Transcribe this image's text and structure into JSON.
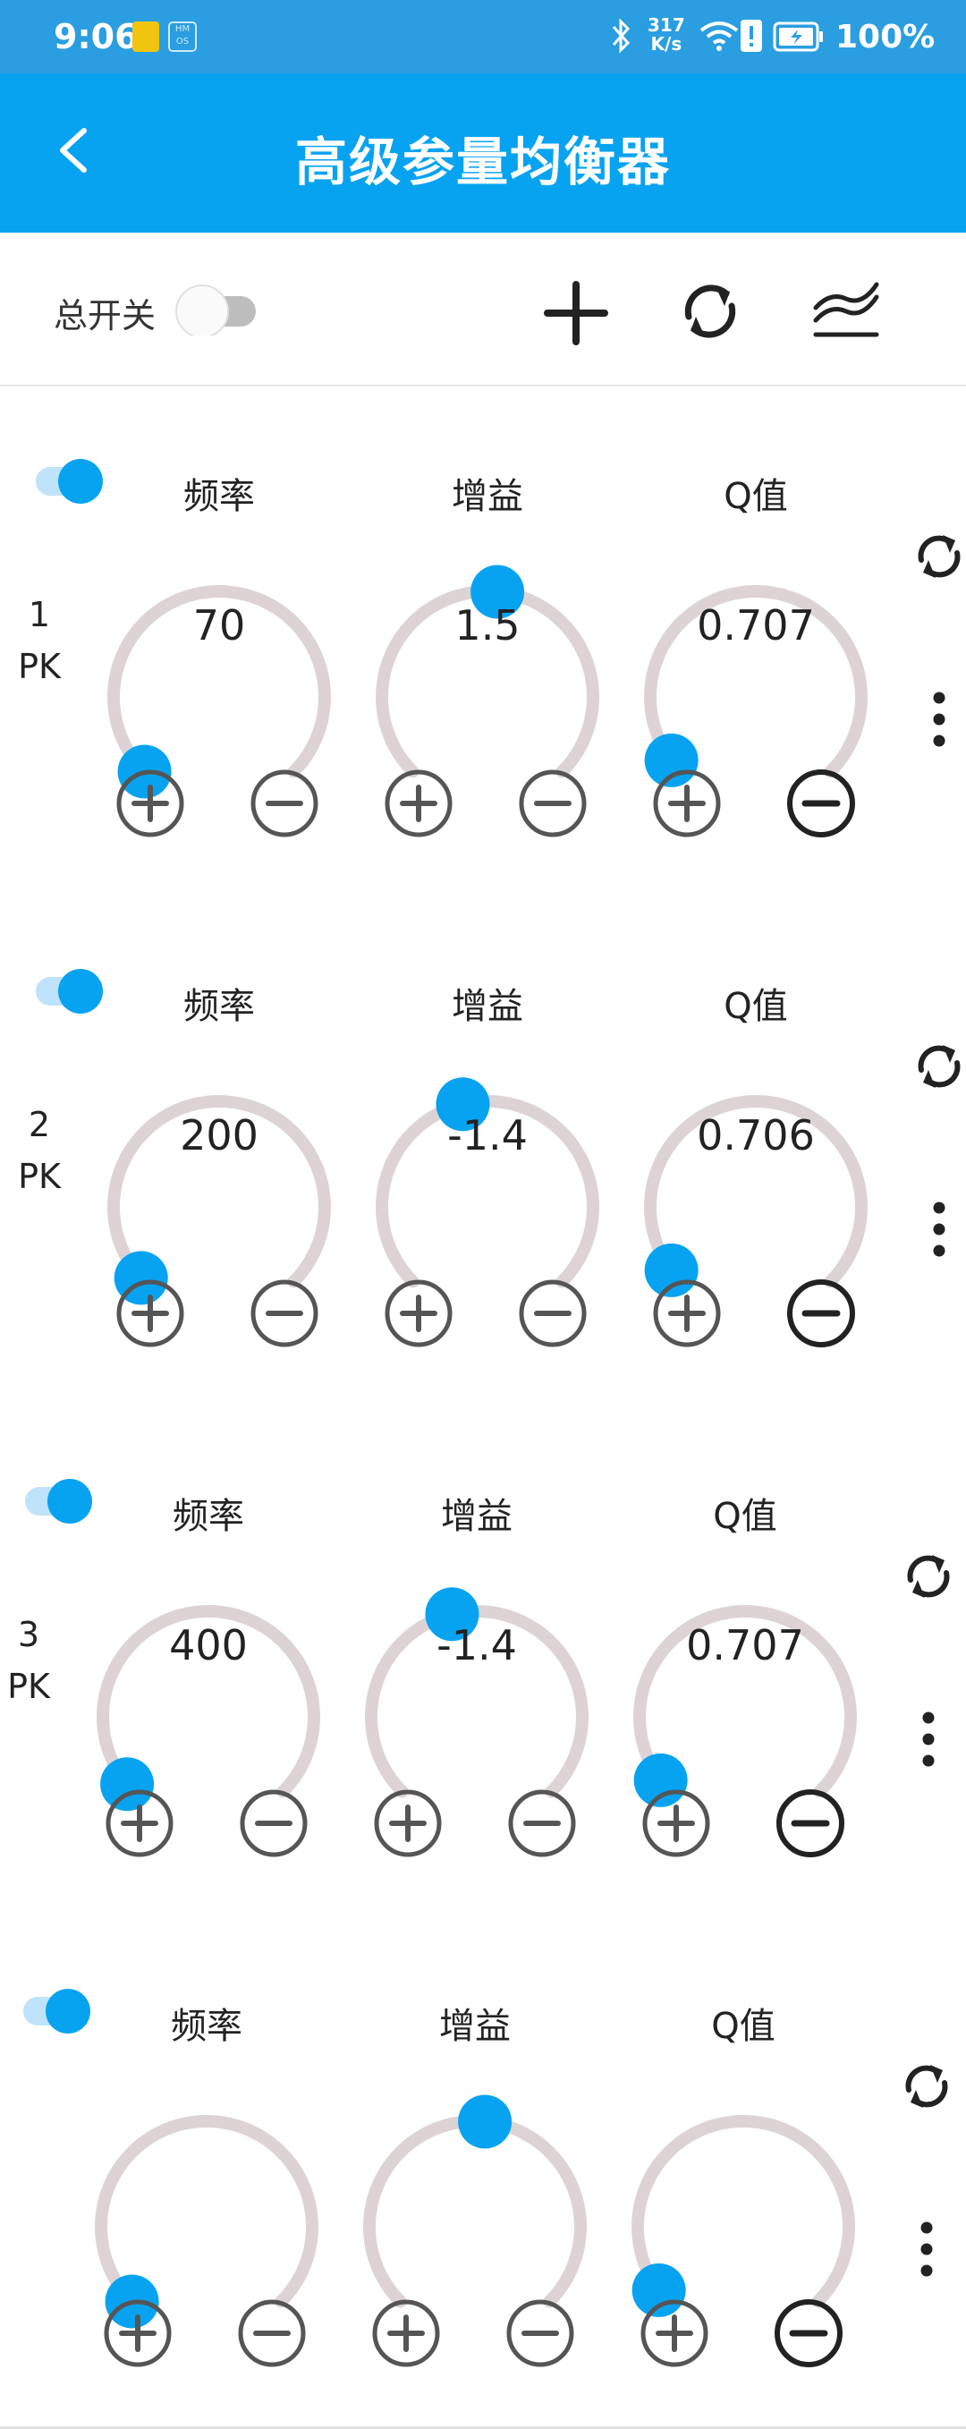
{
  "status_bar": {
    "time": "9:06",
    "net_speed_value": "317",
    "net_speed_unit": "K/s",
    "battery": "100%",
    "hmos_badge": "HM OS",
    "icons": [
      "app-badge-icon",
      "hmos-icon",
      "bluetooth-icon",
      "wifi-icon",
      "alert-icon",
      "battery-icon"
    ]
  },
  "app_bar": {
    "title": "高级参量均衡器",
    "back_icon": "chevron-left-icon"
  },
  "toolbar": {
    "master_switch_label": "总开关",
    "master_switch_on": false,
    "icons": [
      "plus-icon",
      "refresh-icon",
      "eq-curve-icon"
    ]
  },
  "bands": [
    {
      "index": "1",
      "type": "PK",
      "enabled": true,
      "knobs": [
        {
          "label": "频率",
          "value": "70",
          "level": 0.0
        },
        {
          "label": "增益",
          "value": "1.5",
          "level": 0.52
        },
        {
          "label": "Q值",
          "value": "0.707",
          "level": 0.03
        }
      ]
    },
    {
      "index": "2",
      "type": "PK",
      "enabled": true,
      "knobs": [
        {
          "label": "频率",
          "value": "200",
          "level": 0.01
        },
        {
          "label": "增益",
          "value": "-1.4",
          "level": 0.45
        },
        {
          "label": "Q值",
          "value": "0.706",
          "level": 0.03
        }
      ]
    },
    {
      "index": "3",
      "type": "PK",
      "enabled": true,
      "knobs": [
        {
          "label": "频率",
          "value": "400",
          "level": 0.02
        },
        {
          "label": "增益",
          "value": "-1.4",
          "level": 0.45
        },
        {
          "label": "Q值",
          "value": "0.707",
          "level": 0.03
        }
      ]
    },
    {
      "index": "",
      "type": "",
      "enabled": true,
      "knobs": [
        {
          "label": "频率",
          "value": "",
          "level": 0.0
        },
        {
          "label": "增益",
          "value": "",
          "level": 0.52
        },
        {
          "label": "Q值",
          "value": "",
          "level": 0.03
        }
      ]
    }
  ],
  "colors": {
    "status_bar": "#2a9ee0",
    "app_bar": "#07a3f1",
    "accent": "#07a3f1",
    "track": "#ddd3d5",
    "icon_dark": "#333333"
  }
}
